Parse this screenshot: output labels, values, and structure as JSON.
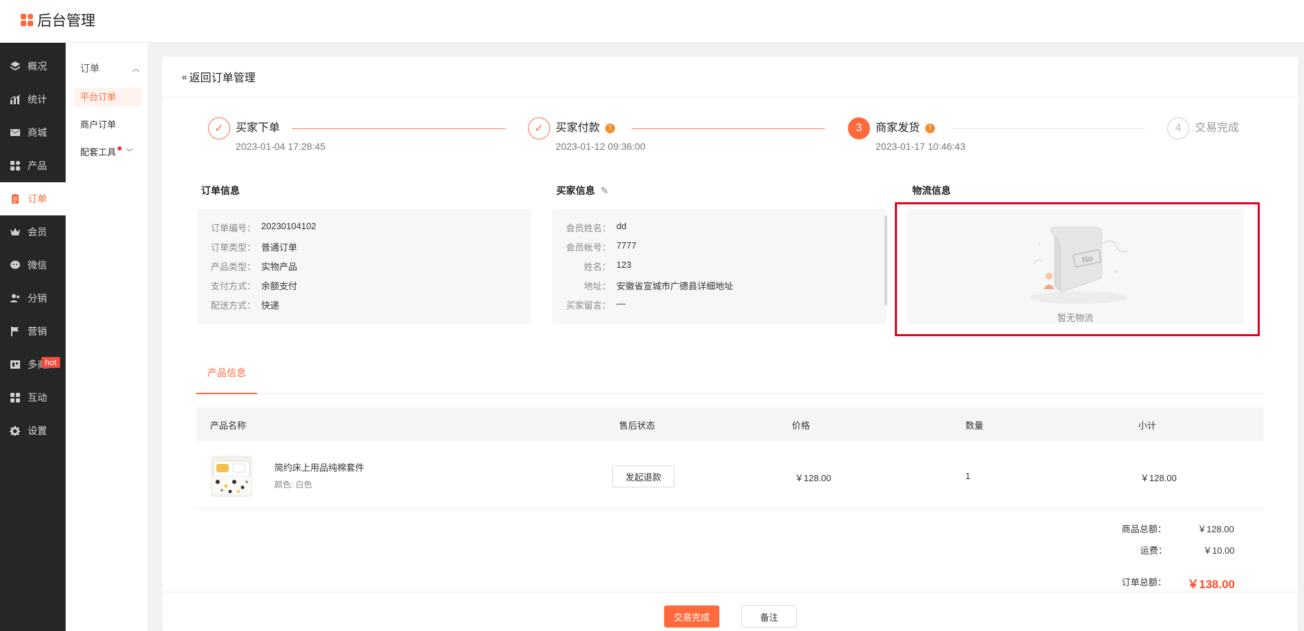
{
  "app": {
    "title": "后台管理"
  },
  "sidebar": {
    "items": [
      {
        "label": "概况",
        "icon": "layers-icon"
      },
      {
        "label": "统计",
        "icon": "chart-icon"
      },
      {
        "label": "商城",
        "icon": "mail-icon"
      },
      {
        "label": "产品",
        "icon": "grid-icon"
      },
      {
        "label": "订单",
        "icon": "clipboard-icon",
        "active": true
      },
      {
        "label": "会员",
        "icon": "crown-icon"
      },
      {
        "label": "微信",
        "icon": "wechat-icon"
      },
      {
        "label": "分销",
        "icon": "users-icon"
      },
      {
        "label": "营销",
        "icon": "flag-icon",
        "badge": "hot"
      },
      {
        "label": "多商户",
        "icon": "store-icon"
      },
      {
        "label": "互动",
        "icon": "apps-icon"
      },
      {
        "label": "设置",
        "icon": "gear-icon"
      }
    ]
  },
  "subnav": {
    "group": "订单",
    "items": [
      "平台订单",
      "商户订单",
      "配套工具"
    ]
  },
  "header": {
    "back": "返回订单管理"
  },
  "steps": [
    {
      "title": "买家下单",
      "time": "2023-01-04 17:28:45",
      "status": "done"
    },
    {
      "title": "买家付款",
      "time": "2023-01-12 09:36:00",
      "status": "done"
    },
    {
      "number": "3",
      "title": "商家发货",
      "time": "2023-01-17 10:46:43",
      "status": "current"
    },
    {
      "number": "4",
      "title": "交易完成",
      "status": "todo"
    }
  ],
  "order_info": {
    "title": "订单信息",
    "fields": [
      {
        "k": "订单编号：",
        "v": "20230104102"
      },
      {
        "k": "订单类型：",
        "v": "普通订单"
      },
      {
        "k": "产品类型：",
        "v": "实物产品"
      },
      {
        "k": "支付方式：",
        "v": "余额支付"
      },
      {
        "k": "配送方式：",
        "v": "快递"
      }
    ]
  },
  "buyer_info": {
    "title": "买家信息",
    "fields": [
      {
        "k": "会员姓名：",
        "v": "dd"
      },
      {
        "k": "会员帐号：",
        "v": "7777"
      },
      {
        "k": "姓名：",
        "v": "123"
      },
      {
        "k": "地址：",
        "v": "安徽省宣城市广德县详细地址"
      },
      {
        "k": "买家留言：",
        "v": "—"
      }
    ]
  },
  "logistics": {
    "title": "物流信息",
    "empty": "暂无物流",
    "stamp": "No"
  },
  "products": {
    "tab": "产品信息",
    "columns": [
      "产品名称",
      "售后状态",
      "价格",
      "数量",
      "小计"
    ],
    "rows": [
      {
        "name": "简约床上用品纯棉套件",
        "spec": "颜色: 白色",
        "action": "发起退款",
        "price": "￥128.00",
        "qty": "1",
        "subtotal": "￥128.00"
      }
    ]
  },
  "summary": {
    "goods_label": "商品总额：",
    "goods": "￥128.00",
    "freight_label": "运费：",
    "freight": "￥10.00",
    "total_label": "订单总额：",
    "total": "￥138.00"
  },
  "footer": {
    "primary": "交易完成",
    "secondary": "备注"
  },
  "colors": {
    "accent": "#ff6a3d",
    "highlight": "#e3001b",
    "sidebar": "#262626"
  }
}
